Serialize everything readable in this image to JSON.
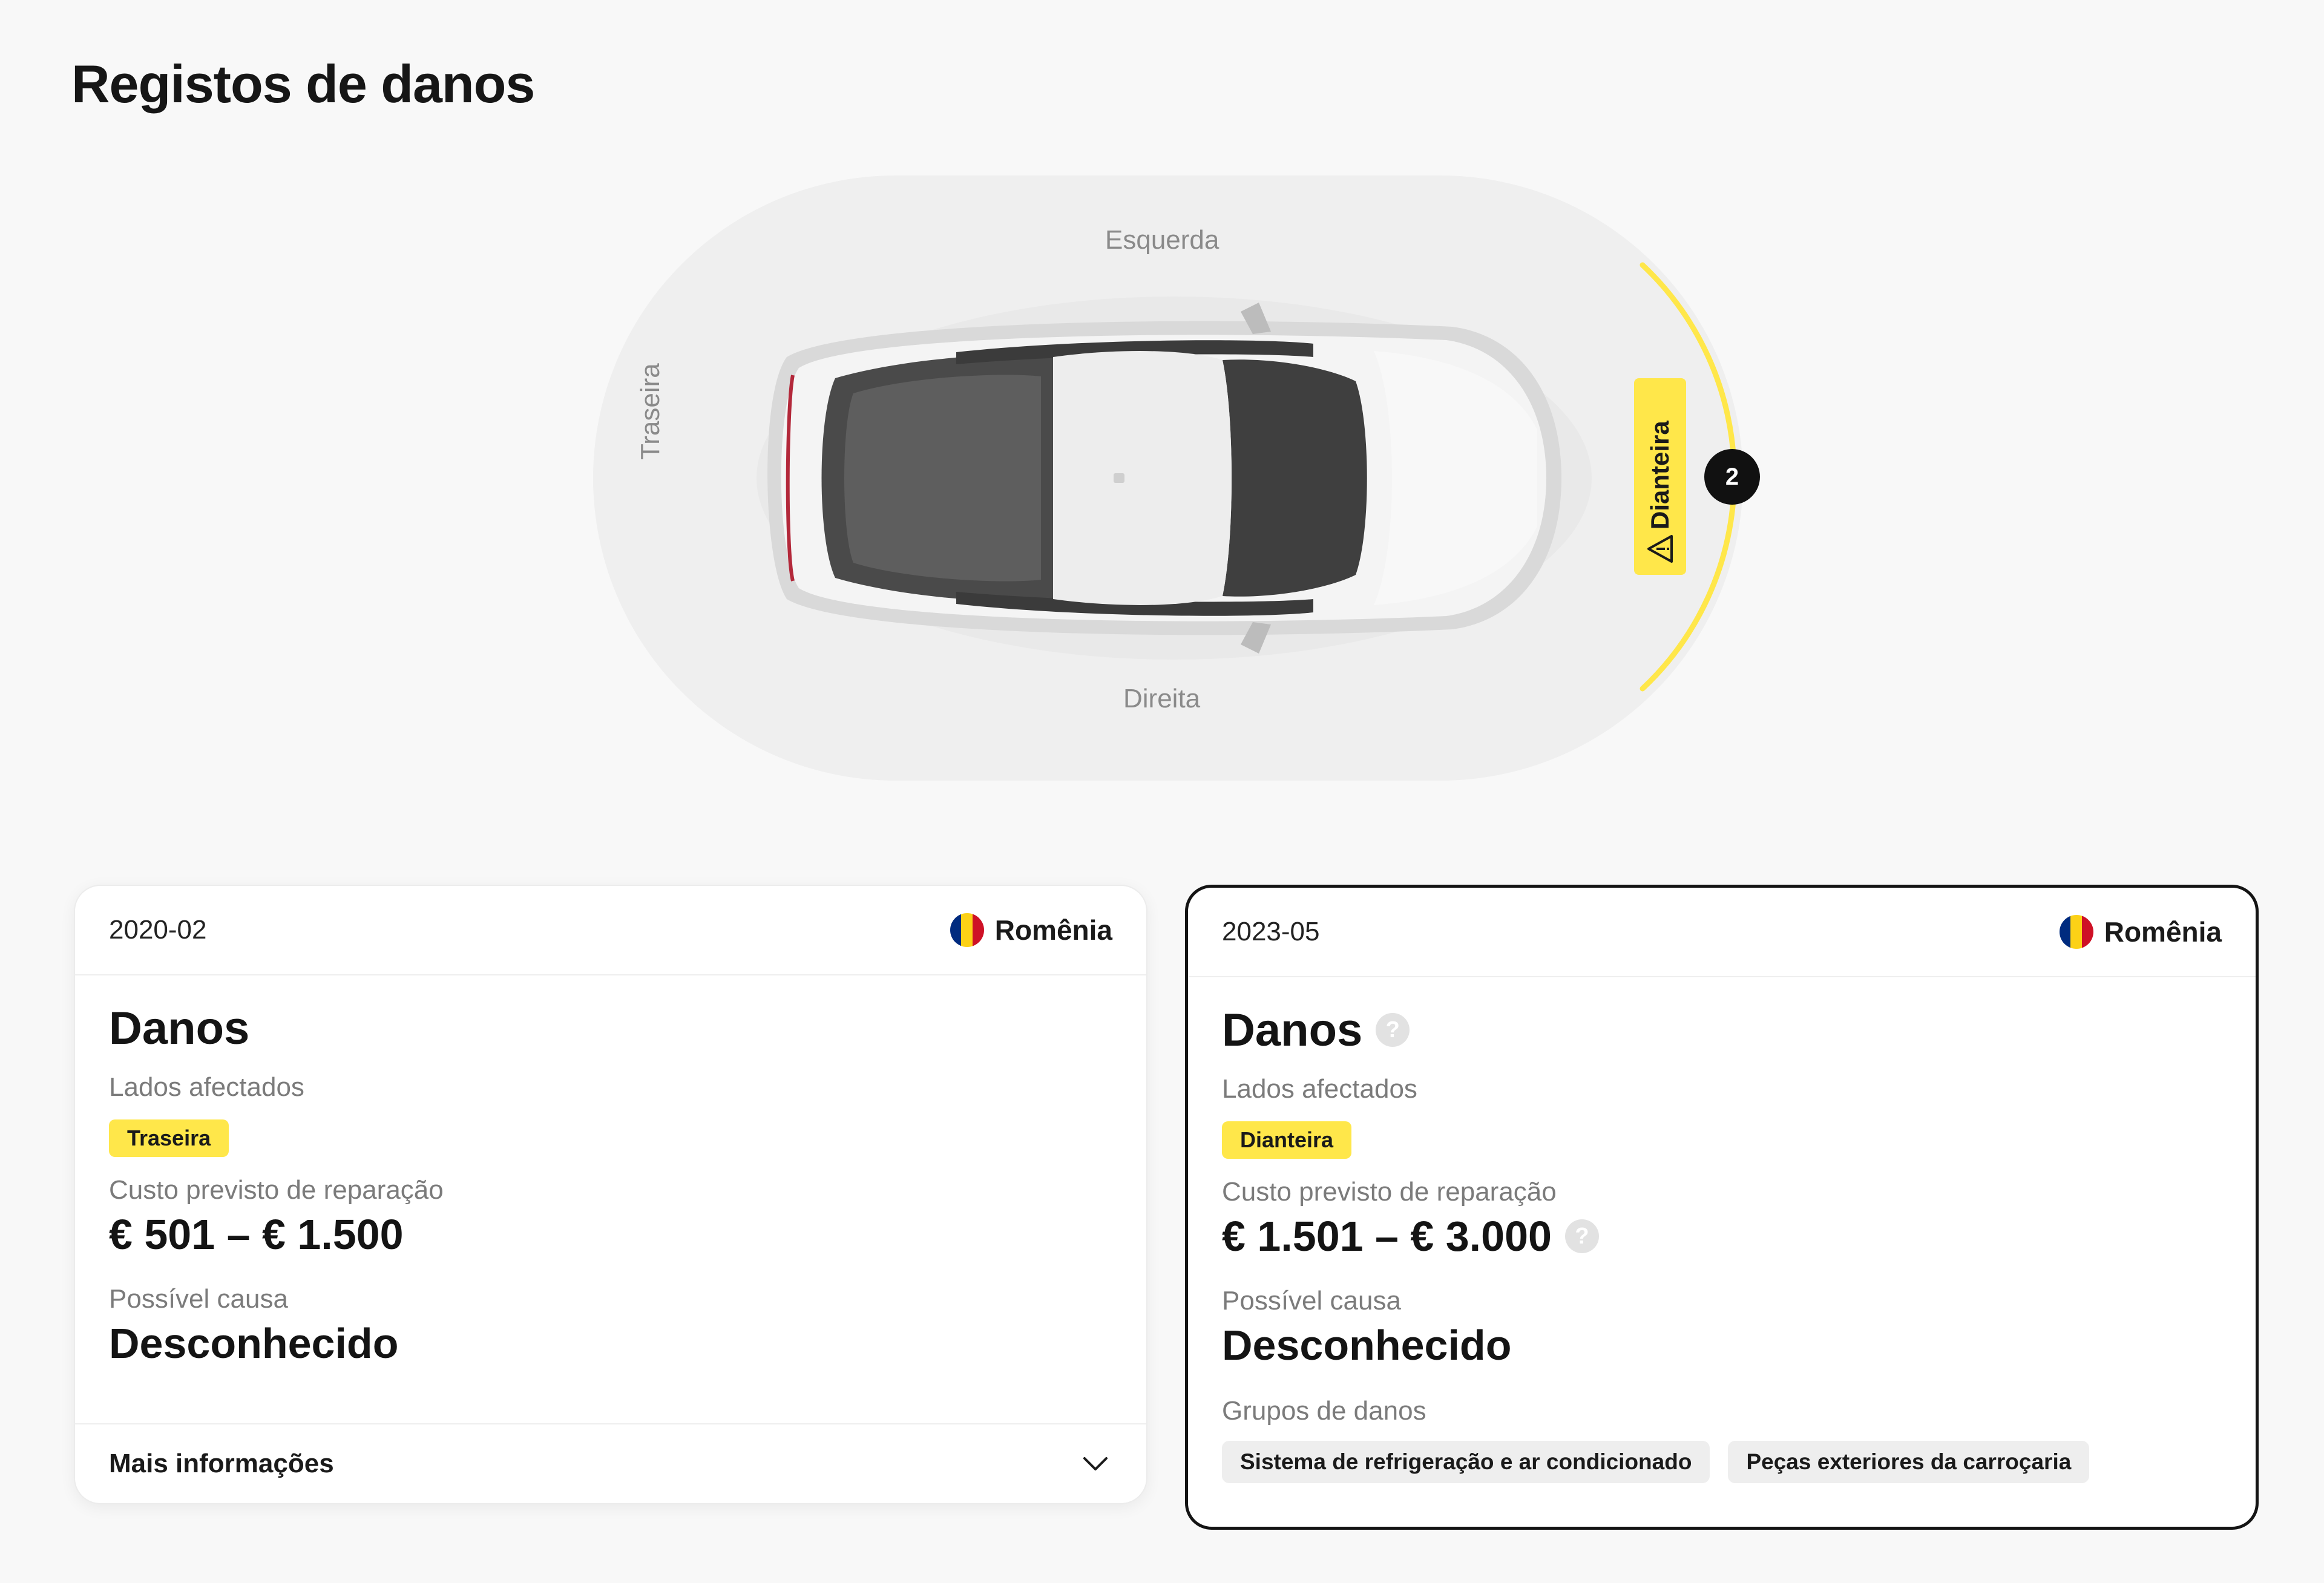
{
  "page": {
    "title": "Registos de danos"
  },
  "diagram": {
    "side_left": "Esquerda",
    "side_right": "Direita",
    "side_rear": "Traseira",
    "side_front": "Dianteira",
    "front_count": "2",
    "highlight_color": "#ffe74a"
  },
  "records": [
    {
      "date": "2020-02",
      "country": "Romênia",
      "heading": "Danos",
      "affected_label": "Lados afectados",
      "affected_side": "Traseira",
      "cost_label": "Custo previsto de reparação",
      "cost_value": "€ 501 – € 1.500",
      "cause_label": "Possível causa",
      "cause_value": "Desconhecido",
      "more_info": "Mais informações"
    },
    {
      "date": "2023-05",
      "country": "Romênia",
      "heading": "Danos",
      "affected_label": "Lados afectados",
      "affected_side": "Dianteira",
      "cost_label": "Custo previsto de reparação",
      "cost_value": "€ 1.501 – € 3.000",
      "cause_label": "Possível causa",
      "cause_value": "Desconhecido",
      "groups_label": "Grupos de danos",
      "groups": [
        "Sistema de refrigeração e ar condicionado",
        "Peças exteriores da carroçaria"
      ]
    }
  ],
  "help_glyph": "?",
  "flag_colors": [
    "#002b7f",
    "#fcd116",
    "#ce1126"
  ]
}
